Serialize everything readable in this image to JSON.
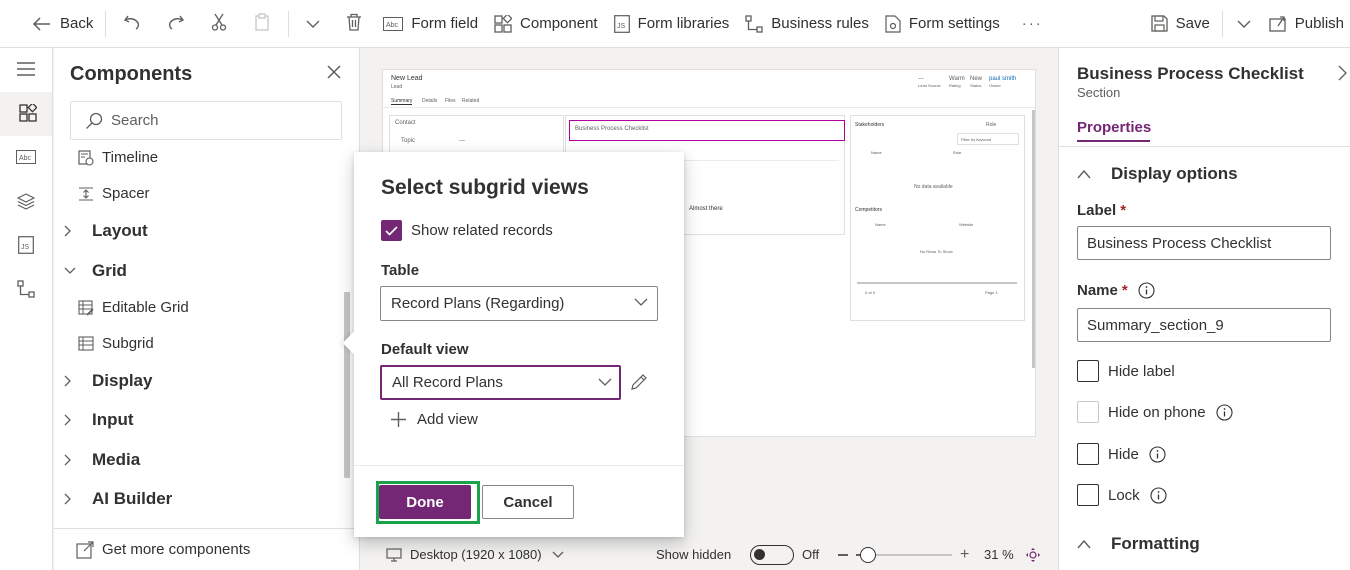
{
  "toolbar": {
    "back": "Back",
    "form_field": "Form field",
    "component": "Component",
    "form_libraries": "Form libraries",
    "business_rules": "Business rules",
    "form_settings": "Form settings",
    "more": "···",
    "save": "Save",
    "publish": "Publish"
  },
  "components": {
    "title": "Components",
    "search_placeholder": "Search",
    "items": {
      "timeline": "Timeline",
      "spacer": "Spacer",
      "editable_grid": "Editable Grid",
      "subgrid": "Subgrid"
    },
    "groups": {
      "layout": "Layout",
      "grid": "Grid",
      "display": "Display",
      "input": "Input",
      "media": "Media",
      "ai_builder": "AI Builder"
    },
    "footer": "Get more components"
  },
  "preview": {
    "form_title": "New Lead",
    "form_subtitle": "Lead",
    "tabs": [
      "Summary",
      "Details",
      "Files",
      "Related"
    ],
    "header_values": [
      "---",
      "Warm",
      "New",
      "paul smith"
    ],
    "header_labels": [
      "Lead Source",
      "Rating",
      "Status",
      "Owner"
    ],
    "contact_section": "Contact",
    "topic_label": "Topic",
    "topic_value": "---",
    "checklist_label": "Business Process Checklist",
    "almost_there": "Almost there",
    "stakeholders": "Stakeholders",
    "add_role": "Role",
    "filter_placeholder": "Filter by keyword",
    "name_col": "Name",
    "role_col": "Role",
    "no_data": "No data available",
    "competitors": "Competitors",
    "comp_name_col": "Name",
    "comp_website_col": "Website",
    "no_rows": "No Rows To Show",
    "pager_left": "0 of 0",
    "pager_right": "Page 1"
  },
  "canvas_footer": {
    "device": "Desktop (1920 x 1080)",
    "show_hidden": "Show hidden",
    "toggle_state": "Off",
    "zoom_percent": 31,
    "zoom_label": "31 %"
  },
  "dialog": {
    "title": "Select subgrid views",
    "show_related_label": "Show related records",
    "show_related_checked": true,
    "table_label": "Table",
    "table_value": "Record Plans (Regarding)",
    "default_view_label": "Default view",
    "default_view_value": "All Record Plans",
    "add_view": "Add view",
    "done": "Done",
    "cancel": "Cancel"
  },
  "properties": {
    "title": "Business Process Checklist",
    "subtitle": "Section",
    "tab": "Properties",
    "display_options": "Display options",
    "label_label": "Label",
    "label_value": "Business Process Checklist",
    "name_label": "Name",
    "name_value": "Summary_section_9",
    "hide_label": "Hide label",
    "hide_on_phone": "Hide on phone",
    "hide": "Hide",
    "lock": "Lock",
    "formatting": "Formatting"
  },
  "colors": {
    "accent": "#742774",
    "highlight_ring": "#1aa34a",
    "selection": "#b4009e"
  }
}
